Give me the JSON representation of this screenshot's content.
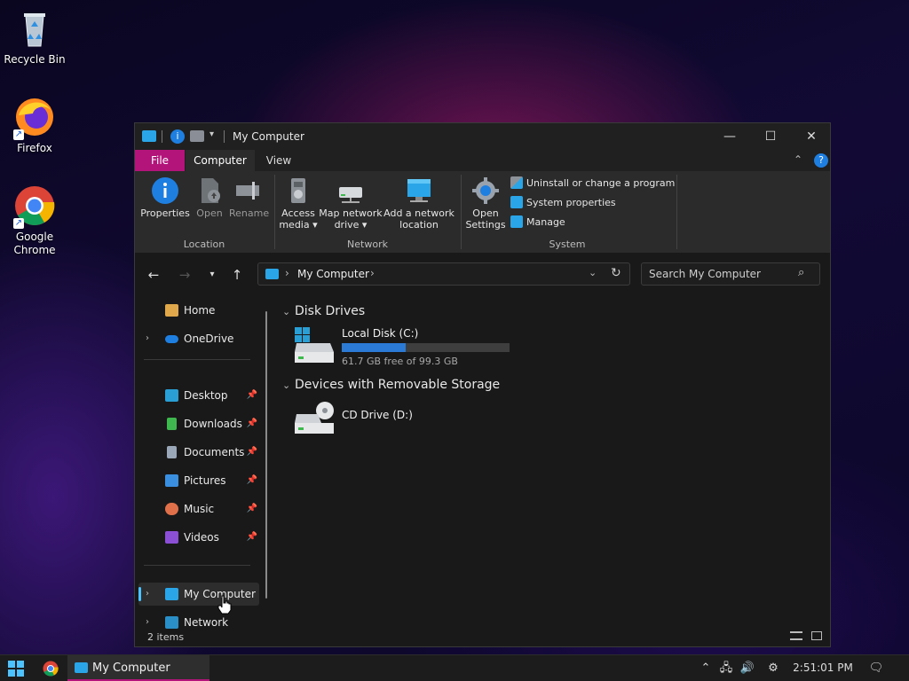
{
  "desktop": {
    "icons": [
      {
        "label": "Recycle Bin",
        "icon": "recycle-bin-icon"
      },
      {
        "label": "Firefox",
        "icon": "firefox-icon"
      },
      {
        "label": "Google Chrome",
        "icon": "chrome-icon"
      }
    ]
  },
  "window": {
    "title": "My Computer",
    "controls": {
      "minimize": "—",
      "maximize": "☐",
      "close": "✕"
    },
    "tabs": [
      {
        "label": "File"
      },
      {
        "label": "Computer"
      },
      {
        "label": "View"
      }
    ],
    "ribbon": {
      "location": {
        "label": "Location",
        "properties": "Properties",
        "open": "Open",
        "rename": "Rename"
      },
      "network": {
        "label": "Network",
        "access_media": "Access media",
        "access_media_l1": "Access",
        "access_media_l2": "media",
        "map_drive_l1": "Map network",
        "map_drive_l2": "drive",
        "add_location_l1": "Add a network",
        "add_location_l2": "location"
      },
      "system": {
        "label": "System",
        "open_settings_l1": "Open",
        "open_settings_l2": "Settings",
        "uninstall": "Uninstall or change a program",
        "properties": "System properties",
        "manage": "Manage"
      }
    },
    "address": {
      "path": "My Computer",
      "separator": "›"
    },
    "search": {
      "placeholder": "Search My Computer"
    },
    "sidebar": {
      "quick": [
        {
          "label": "Home",
          "chev": ""
        },
        {
          "label": "OneDrive",
          "chev": "›"
        }
      ],
      "pinned": [
        {
          "label": "Desktop",
          "color": "#2a9fd6"
        },
        {
          "label": "Downloads",
          "color": "#3fb84f"
        },
        {
          "label": "Documents",
          "color": "#9aa7b8"
        },
        {
          "label": "Pictures",
          "color": "#3b8fe0"
        },
        {
          "label": "Music",
          "color": "#e0704a"
        },
        {
          "label": "Videos",
          "color": "#8b4fd6"
        }
      ],
      "bottom": [
        {
          "label": "My Computer",
          "selected": true
        },
        {
          "label": "Network",
          "selected": false
        }
      ]
    },
    "content": {
      "sections": [
        {
          "title": "Disk Drives"
        },
        {
          "title": "Devices with Removable Storage"
        }
      ],
      "local_disk": {
        "name": "Local Disk (C:)",
        "free_text": "61.7 GB free of 99.3 GB",
        "used_fraction": 0.38
      },
      "cd_drive": {
        "name": "CD Drive (D:)"
      }
    },
    "status": {
      "items": "2 items"
    }
  },
  "taskbar": {
    "app_label": "My Computer",
    "time": "2:51:01 PM"
  },
  "colors": {
    "accent": "#b3147a",
    "selection": "#4cc2ff",
    "progress": "#2b7bd6"
  }
}
